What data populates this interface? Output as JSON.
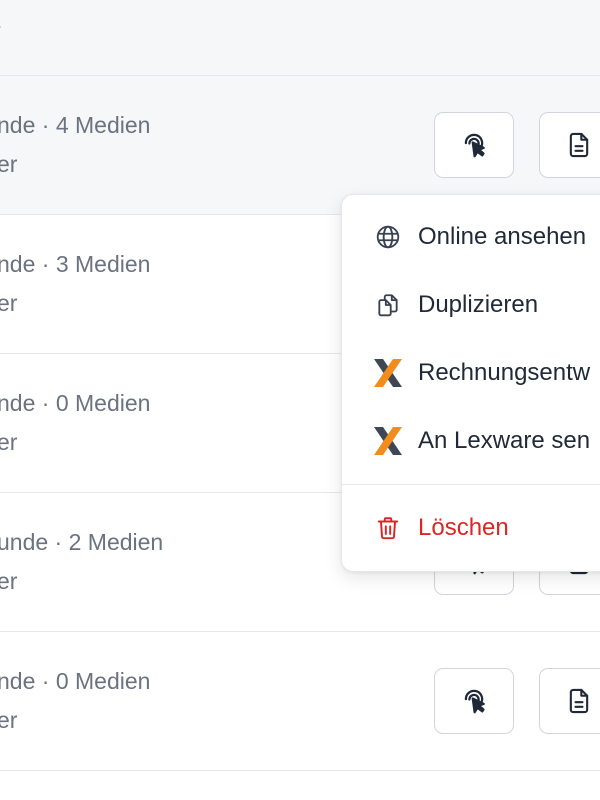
{
  "rows": [
    {
      "meta": "nde · 4 Medien",
      "sub": "er"
    },
    {
      "meta": "nde · 3 Medien",
      "sub": "er"
    },
    {
      "meta": "nde · 0 Medien",
      "sub": "er"
    },
    {
      "meta": "unde · 2 Medien",
      "sub": "er"
    },
    {
      "meta": "nde · 0 Medien",
      "sub": "er"
    }
  ],
  "menu": {
    "view_online": "Online ansehen",
    "duplicate": "Duplizieren",
    "invoice_draft": "Rechnungsentw",
    "send_lexware": "An Lexware sen",
    "delete": "Löschen"
  },
  "colors": {
    "danger": "#dc2626",
    "lexware_orange": "#f28c1c",
    "lexware_dark": "#3f4654",
    "muted_text": "#6b7280"
  },
  "icons": {
    "row_action_1": "touch-pointer-icon",
    "row_action_2": "document-icon",
    "view_online": "globe-icon",
    "duplicate": "copy-icon",
    "invoice_draft": "lexware-logo-icon",
    "send_lexware": "lexware-logo-icon",
    "delete": "trash-icon"
  }
}
